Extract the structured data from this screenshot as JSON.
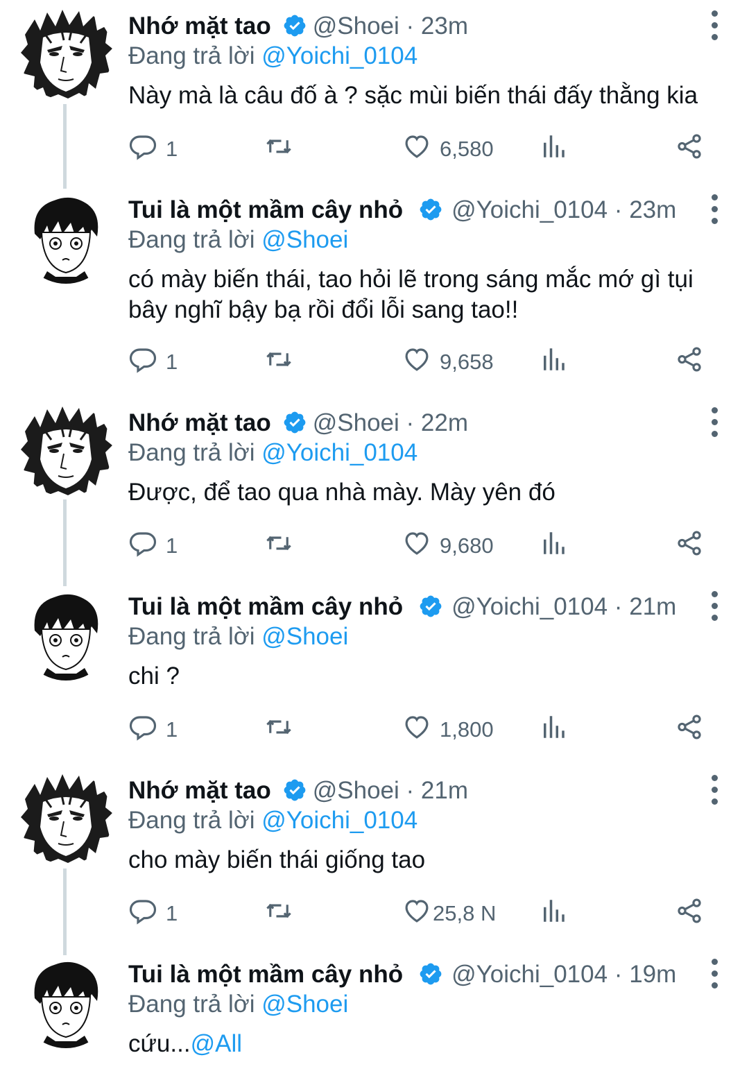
{
  "ui": {
    "verified_color": "#1d9bf0",
    "mention_color": "#1d9bf0",
    "muted_color": "#536471"
  },
  "tweets": [
    {
      "name": "Nhớ mặt tao",
      "handle": "@Shoei",
      "time": "23m",
      "avatar": "shoei-avatar",
      "replying_prefix": "Đang trả lời",
      "replying_to": "@Yoichi_0104",
      "text": "Này mà là câu đố à ? sặc mùi biến thái đấy thằng kia",
      "text_mention": "",
      "replies": "1",
      "likes": "6,580"
    },
    {
      "name": "Tui là một mầm cây nhỏ",
      "handle": "@Yoichi_0104",
      "time": "23m",
      "avatar": "yoichi-avatar",
      "replying_prefix": "Đang trả lời",
      "replying_to": "@Shoei",
      "text": "có mày biến thái, tao hỏi lẽ trong sáng mắc mớ gì tụi bây nghĩ bậy bạ rồi đổi lỗi sang tao!!",
      "text_mention": "",
      "replies": "1",
      "likes": "9,658"
    },
    {
      "name": "Nhớ mặt tao",
      "handle": "@Shoei",
      "time": "22m",
      "avatar": "shoei-avatar",
      "replying_prefix": "Đang trả lời",
      "replying_to": "@Yoichi_0104",
      "text": "Được, để tao qua nhà mày. Mày yên đó",
      "text_mention": "",
      "replies": "1",
      "likes": "9,680"
    },
    {
      "name": "Tui là một mầm cây nhỏ",
      "handle": "@Yoichi_0104",
      "time": "21m",
      "avatar": "yoichi-avatar",
      "replying_prefix": "Đang trả lời",
      "replying_to": "@Shoei",
      "text": "chi ?",
      "text_mention": "",
      "replies": "1",
      "likes": "1,800"
    },
    {
      "name": "Nhớ mặt tao",
      "handle": "@Shoei",
      "time": "21m",
      "avatar": "shoei-avatar",
      "replying_prefix": "Đang trả lời",
      "replying_to": "@Yoichi_0104",
      "text": "cho mày biến thái giống tao",
      "text_mention": "",
      "replies": "1",
      "likes": "25,8 N"
    },
    {
      "name": "Tui là một mầm cây nhỏ",
      "handle": "@Yoichi_0104",
      "time": "19m",
      "avatar": "yoichi-avatar",
      "replying_prefix": "Đang trả lời",
      "replying_to": "@Shoei",
      "text": "cứu...",
      "text_mention": "@All",
      "replies": "",
      "likes": ""
    }
  ]
}
